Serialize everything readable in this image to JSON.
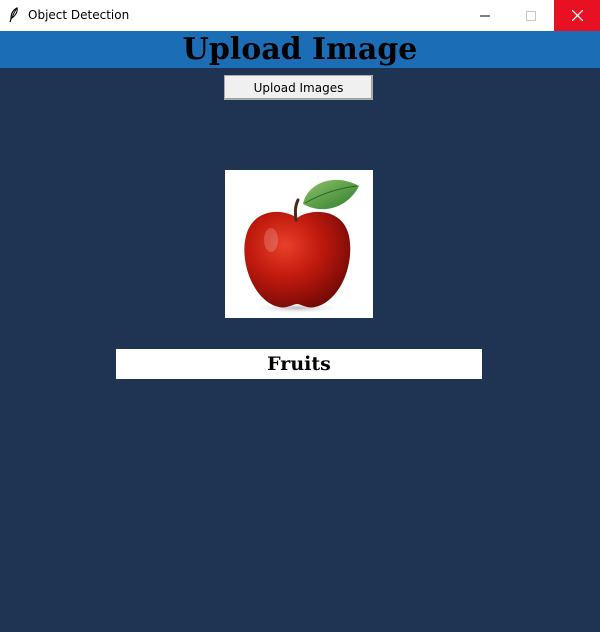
{
  "window": {
    "title": "Object Detection",
    "app_icon": "feather-icon",
    "controls": {
      "minimize_icon": "minimize-icon",
      "maximize_icon": "maximize-icon",
      "close_icon": "close-icon",
      "close_color": "#e81123"
    }
  },
  "header": {
    "title": "Upload Image",
    "background": "#1b6eb6"
  },
  "main": {
    "background": "#1f3452",
    "upload_button_label": "Upload Images",
    "preview_image": "red-apple-image",
    "result_label": "Fruits"
  }
}
